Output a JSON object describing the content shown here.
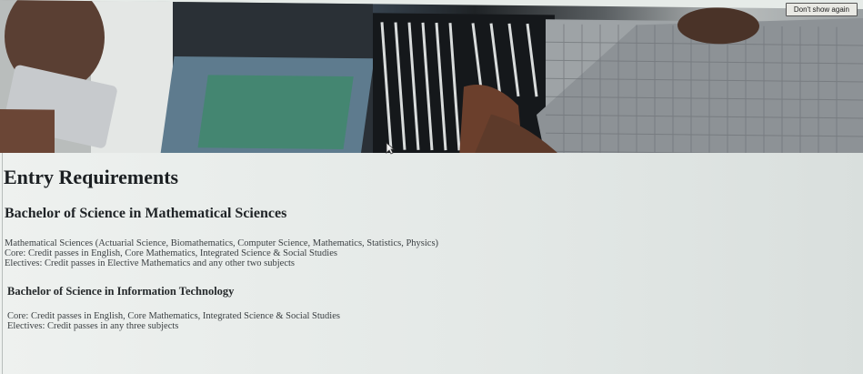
{
  "header": {
    "dont_show_label": "Don't show again"
  },
  "main": {
    "title": "Entry Requirements",
    "programmes": [
      {
        "title": "Bachelor of Science in Mathematical Sciences",
        "lines": [
          "Mathematical Sciences (Actuarial Science, Biomathematics, Computer Science, Mathematics, Statistics, Physics)",
          "Core: Credit passes in English, Core Mathematics, Integrated Science & Social Studies",
          "Electives: Credit passes in Elective Mathematics and any other two subjects"
        ]
      },
      {
        "title": "Bachelor of Science in Information Technology",
        "lines": [
          "Core: Credit passes in English, Core Mathematics, Integrated Science & Social Studies",
          "Electives: Credit passes in any three subjects"
        ]
      }
    ]
  }
}
